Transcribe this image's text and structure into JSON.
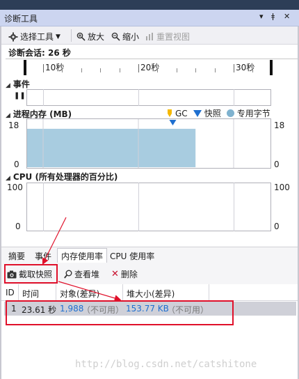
{
  "window": {
    "title": "诊断工具",
    "pin_glyph": "▾",
    "pushpin_glyph": "ǂ",
    "close_glyph": "✕"
  },
  "toolbar": {
    "select_tools": "选择工具",
    "zoom_in": "放大",
    "zoom_out": "缩小",
    "reset_view": "重置视图"
  },
  "session": {
    "label": "诊断会话: 26 秒"
  },
  "timeline": {
    "ticks": [
      "10秒",
      "20秒",
      "30秒"
    ]
  },
  "events": {
    "header": "事件",
    "pause_glyph": "❚❚"
  },
  "memory": {
    "header": "进程内存 (MB)",
    "legend": {
      "gc": "GC",
      "snapshot": "快照",
      "private_bytes": "专用字节"
    },
    "y_max": "18",
    "y_min": "0"
  },
  "cpu": {
    "header": "CPU (所有处理器的百分比)",
    "y_max": "100",
    "y_min": "0"
  },
  "tabs": [
    "摘要",
    "事件",
    "内存使用率",
    "CPU 使用率"
  ],
  "subtoolbar": {
    "take_snapshot": "截取快照",
    "view_heap": "查看堆",
    "delete": "删除"
  },
  "table": {
    "headers": [
      "ID",
      "时间",
      "对象(差异)",
      "堆大小(差异)"
    ],
    "rows": [
      {
        "id": "1",
        "time": "23.61 秒",
        "objects": "1,988",
        "objects_diff": "（不可用）",
        "heap": "153.77 KB",
        "heap_diff": "（不可用）"
      }
    ]
  },
  "watermark": "http://blog.csdn.net/catshitone",
  "chart_data": {
    "type": "area",
    "title": "进程内存 (MB)",
    "ylim": [
      0,
      18
    ],
    "x": [
      "0秒",
      "10秒",
      "20秒",
      "26秒"
    ],
    "series": [
      {
        "name": "专用字节",
        "values": [
          16,
          16,
          16,
          16
        ]
      }
    ],
    "snapshot_at_seconds": 23.61
  },
  "colors": {
    "memory_fill": "#a8cce0",
    "gc_marker": "#f5b800",
    "snapshot_marker": "#1e6fd0",
    "annotation_red": "#e0102a"
  }
}
